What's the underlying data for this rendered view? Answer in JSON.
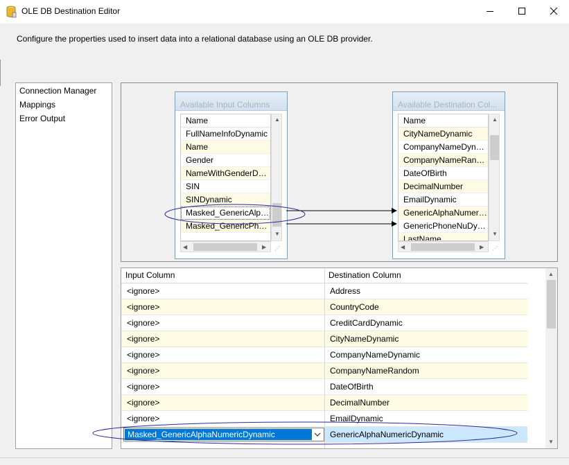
{
  "window": {
    "title": "OLE DB Destination Editor",
    "icon": "database-icon"
  },
  "description": "Configure the properties used to insert data into a relational database using an OLE DB provider.",
  "nav": {
    "items": [
      {
        "label": "Connection Manager"
      },
      {
        "label": "Mappings"
      },
      {
        "label": "Error Output"
      }
    ]
  },
  "input_columns": {
    "title": "Available Input Columns",
    "header": "Name",
    "rows": [
      "FullNameInfoDynamic",
      "Name",
      "Gender",
      "NameWithGenderDyn...",
      "SIN",
      "SINDynamic",
      "Masked_GenericAlph...",
      "Masked_GenericPho..."
    ]
  },
  "destination_columns": {
    "title": "Available Destination Col...",
    "header": "Name",
    "rows": [
      "CityNameDynamic",
      "CompanyNameDynamic",
      "CompanyNameRandom",
      "DateOfBirth",
      "DecimalNumber",
      "EmailDynamic",
      "GenericAlphaNumeric...",
      "GenericPhoneNuDyn...",
      "LastName"
    ]
  },
  "grid": {
    "headers": {
      "input": "Input Column",
      "destination": "Destination Column"
    },
    "rows": [
      {
        "input": "<ignore>",
        "destination": "Address"
      },
      {
        "input": "<ignore>",
        "destination": "CountryCode"
      },
      {
        "input": "<ignore>",
        "destination": "CreditCardDynamic"
      },
      {
        "input": "<ignore>",
        "destination": "CityNameDynamic"
      },
      {
        "input": "<ignore>",
        "destination": "CompanyNameDynamic"
      },
      {
        "input": "<ignore>",
        "destination": "CompanyNameRandom"
      },
      {
        "input": "<ignore>",
        "destination": "DateOfBirth"
      },
      {
        "input": "<ignore>",
        "destination": "DecimalNumber"
      },
      {
        "input": "<ignore>",
        "destination": "EmailDynamic"
      },
      {
        "input": "Masked_GenericAlphaNumericDynamic",
        "destination": "GenericAlphaNumericDynamic"
      }
    ],
    "selected_row": 9
  },
  "colors": {
    "alt_row": "#fdfbe3",
    "selection": "#0078d7",
    "selected_cell": "#cce8ff",
    "annotation": "#2b2b9b"
  }
}
